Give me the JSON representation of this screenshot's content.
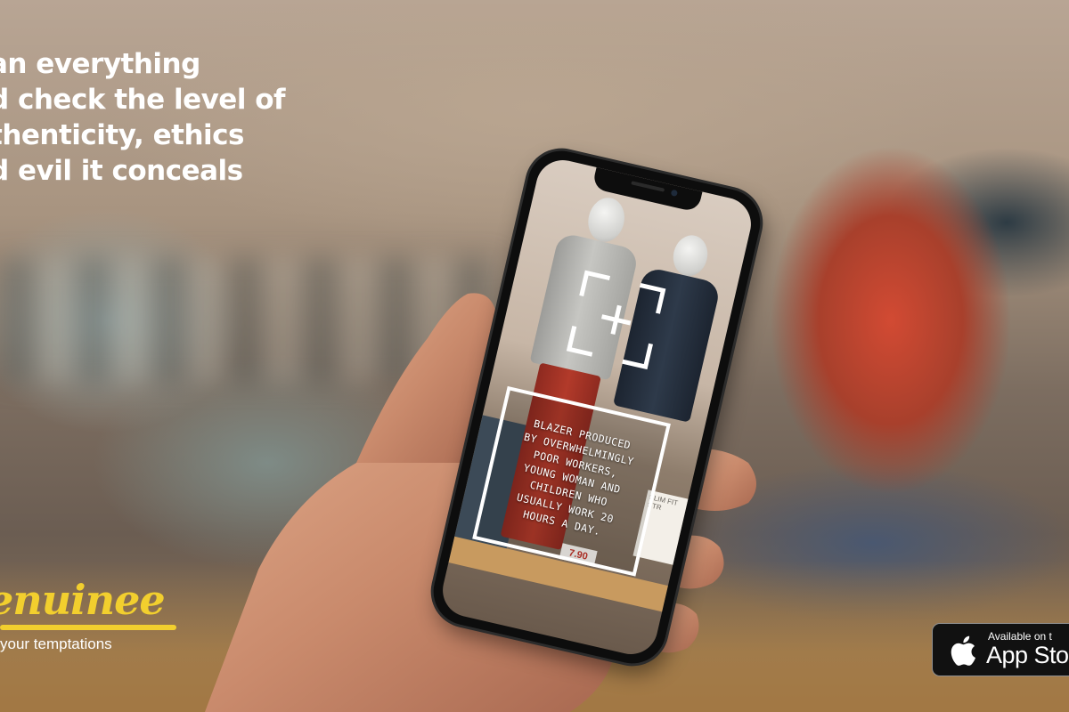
{
  "headline": {
    "lines": [
      "an everything",
      "d check the level of",
      "thenticity, ethics",
      "d evil it conceals"
    ]
  },
  "brand": {
    "name": "enuinee",
    "tagline": "your temptations",
    "color": "#f2cf2e"
  },
  "phone_screen": {
    "scan_icon": "scan-reticle-icon",
    "info_lines": [
      "BLAZER PRODUCED",
      "BY OVERWHELMINGLY",
      "POOR WORKERS,",
      "YOUNG WOMAN AND",
      "CHILDREN WHO",
      "USUALLY WORK 20",
      "HOURS A DAY."
    ],
    "store_sign": "SLIM FIT STR",
    "price": "7.90"
  },
  "app_store_badge": {
    "small_text": "Available on t",
    "big_text": "App Sto",
    "icon": "apple-icon"
  }
}
